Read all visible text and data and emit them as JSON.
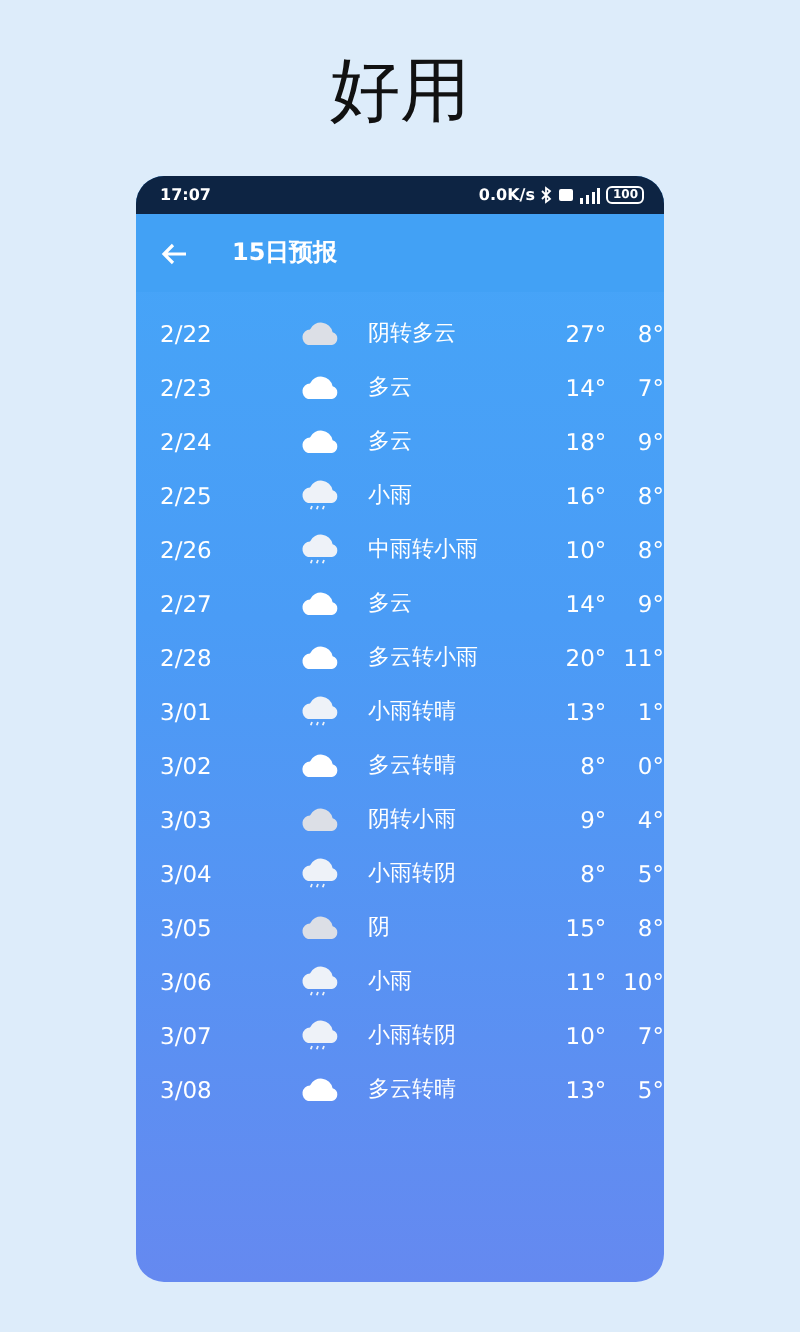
{
  "headline": "好用",
  "status_bar": {
    "time": "17:07",
    "speed": "0.0K/s",
    "battery": "100"
  },
  "header": {
    "title": "15日预报"
  },
  "days": [
    {
      "date": "2/22",
      "kind": "overcast",
      "desc": "阴转多云",
      "high": "27°",
      "low": "8°"
    },
    {
      "date": "2/23",
      "kind": "cloud",
      "desc": "多云",
      "high": "14°",
      "low": "7°"
    },
    {
      "date": "2/24",
      "kind": "cloud",
      "desc": "多云",
      "high": "18°",
      "low": "9°"
    },
    {
      "date": "2/25",
      "kind": "rain",
      "desc": "小雨",
      "high": "16°",
      "low": "8°"
    },
    {
      "date": "2/26",
      "kind": "rain",
      "desc": "中雨转小雨",
      "high": "10°",
      "low": "8°"
    },
    {
      "date": "2/27",
      "kind": "cloud",
      "desc": "多云",
      "high": "14°",
      "low": "9°"
    },
    {
      "date": "2/28",
      "kind": "cloud",
      "desc": "多云转小雨",
      "high": "20°",
      "low": "11°"
    },
    {
      "date": "3/01",
      "kind": "rain",
      "desc": "小雨转晴",
      "high": "13°",
      "low": "1°"
    },
    {
      "date": "3/02",
      "kind": "cloud",
      "desc": "多云转晴",
      "high": "8°",
      "low": "0°"
    },
    {
      "date": "3/03",
      "kind": "overcast",
      "desc": "阴转小雨",
      "high": "9°",
      "low": "4°"
    },
    {
      "date": "3/04",
      "kind": "rain",
      "desc": "小雨转阴",
      "high": "8°",
      "low": "5°"
    },
    {
      "date": "3/05",
      "kind": "overcast",
      "desc": "阴",
      "high": "15°",
      "low": "8°"
    },
    {
      "date": "3/06",
      "kind": "rain",
      "desc": "小雨",
      "high": "11°",
      "low": "10°"
    },
    {
      "date": "3/07",
      "kind": "rain",
      "desc": "小雨转阴",
      "high": "10°",
      "low": "7°"
    },
    {
      "date": "3/08",
      "kind": "cloud",
      "desc": "多云转晴",
      "high": "13°",
      "low": "5°"
    }
  ]
}
